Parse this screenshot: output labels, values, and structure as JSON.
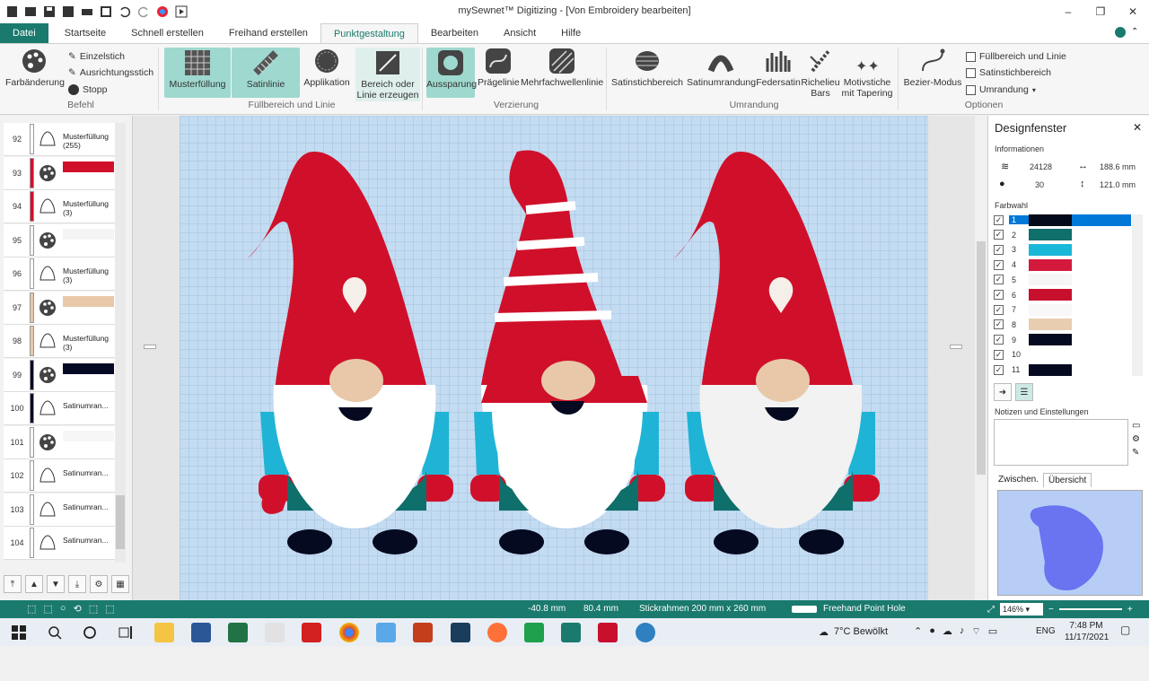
{
  "app": {
    "title": "mySewnet™ Digitizing - [Von Embroidery bearbeiten]",
    "window_controls": [
      "–",
      "❐",
      "✕"
    ]
  },
  "tabs": [
    "Datei",
    "Startseite",
    "Schnell erstellen",
    "Freihand erstellen",
    "Punktgestaltung",
    "Bearbeiten",
    "Ansicht",
    "Hilfe"
  ],
  "ribbon": {
    "befehl": {
      "label": "Befehl",
      "farbaenderung": "Farbänderung",
      "einzelstich": "Einzelstich",
      "ausrichtungsstich": "Ausrichtungsstich",
      "stopp": "Stopp"
    },
    "fuellbereich": {
      "label": "Füllbereich und Linie",
      "musterfuellung": "Musterfüllung",
      "satinlinie": "Satinlinie",
      "applikation": "Applikation",
      "bereich": "Bereich oder Linie erzeugen"
    },
    "verzierung": {
      "label": "Verzierung",
      "aussparung": "Aussparung",
      "praegelinie": "Prägelinie",
      "mehrfachwellenlinie": "Mehrfachwellenlinie"
    },
    "umrandung": {
      "label": "Umrandung",
      "satinstichbereich": "Satinstichbereich",
      "satinumrandung": "Satinumrandung",
      "federsatin": "Federsatin",
      "richelieu": "Richelieu Bars",
      "motivstiche": "Motivstiche mit Tapering"
    },
    "optionen": {
      "label": "Optionen",
      "bezier": "Bezier-Modus",
      "fb_linie": "Füllbereich und Linie",
      "satinstichbereich": "Satinstichbereich",
      "umrandung": "Umrandung"
    }
  },
  "objects": [
    {
      "num": "92",
      "type": "Musterfüllung",
      "sub": "(255)",
      "color": "#ffffff"
    },
    {
      "num": "93",
      "type": "",
      "sub": "",
      "color": "#d0102a"
    },
    {
      "num": "94",
      "type": "Musterfüllung",
      "sub": "(3)",
      "color": "#d0102a"
    },
    {
      "num": "95",
      "type": "",
      "sub": "",
      "color": "#f4f4f4"
    },
    {
      "num": "96",
      "type": "Musterfüllung",
      "sub": "(3)",
      "color": "#ffffff"
    },
    {
      "num": "97",
      "type": "",
      "sub": "",
      "color": "#e8c8a8"
    },
    {
      "num": "98",
      "type": "Musterfüllung",
      "sub": "(3)",
      "color": "#e8c8a8"
    },
    {
      "num": "99",
      "type": "",
      "sub": "",
      "color": "#040a24"
    },
    {
      "num": "100",
      "type": "Satinumran...",
      "sub": "",
      "color": "#040a24"
    },
    {
      "num": "101",
      "type": "",
      "sub": "",
      "color": "#f6f6f6"
    },
    {
      "num": "102",
      "type": "Satinumran...",
      "sub": "",
      "color": "#ffffff"
    },
    {
      "num": "103",
      "type": "Satinumran...",
      "sub": "",
      "color": "#ffffff"
    },
    {
      "num": "104",
      "type": "Satinumran...",
      "sub": "",
      "color": "#ffffff"
    }
  ],
  "design": {
    "title": "Designfenster",
    "info_label": "Informationen",
    "stitches": "24128",
    "width": "188.6 mm",
    "colors_count": "30",
    "height": "121.0 mm",
    "farbwahl": "Farbwahl",
    "colors": [
      {
        "n": "1",
        "hex": "#030a1a"
      },
      {
        "n": "2",
        "hex": "#0f6f6a"
      },
      {
        "n": "3",
        "hex": "#19b8d8"
      },
      {
        "n": "4",
        "hex": "#d41a3c"
      },
      {
        "n": "5",
        "hex": "#f6f6f6"
      },
      {
        "n": "6",
        "hex": "#c8102e"
      },
      {
        "n": "7",
        "hex": "#f8f8f8"
      },
      {
        "n": "8",
        "hex": "#e9cdb0"
      },
      {
        "n": "9",
        "hex": "#050a20"
      },
      {
        "n": "10",
        "hex": "#ffffff"
      },
      {
        "n": "11",
        "hex": "#050a20"
      }
    ],
    "notes_label": "Notizen und Einstellungen",
    "tab_zwischen": "Zwischen.",
    "tab_uebersicht": "Übersicht"
  },
  "status": {
    "x": "-40.8 mm",
    "y": "80.4 mm",
    "hoop": "Stickrahmen 200 mm x 260 mm",
    "tool": "Freehand Point Hole",
    "zoom": "146%"
  },
  "taskbar": {
    "weather": "7°C  Bewölkt",
    "lang": "ENG",
    "time": "7:48 PM",
    "date": "11/17/2021"
  },
  "colors": {
    "accent": "#1a7a6d",
    "selected_ribbon": "#9fd8cf",
    "hoop": "#c4dcf2"
  }
}
